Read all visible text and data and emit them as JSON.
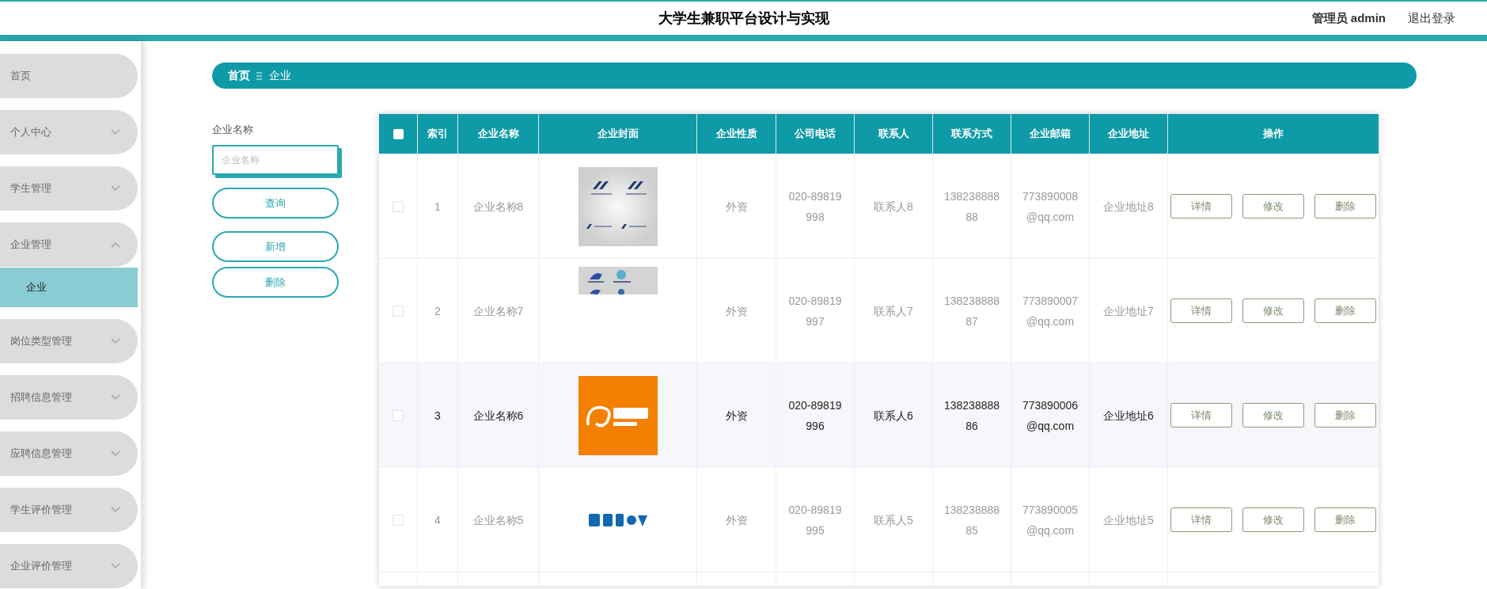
{
  "header": {
    "title": "大学生兼职平台设计与实现",
    "user": "管理员 admin",
    "logout": "退出登录"
  },
  "sidebar": {
    "items": [
      {
        "label": "首页",
        "selected": false
      },
      {
        "label": "个人中心",
        "selected": false,
        "expanded": false
      },
      {
        "label": "学生管理",
        "selected": false,
        "expanded": false
      },
      {
        "label": "企业管理",
        "selected": false,
        "expanded": true,
        "children": [
          {
            "label": "企业",
            "selected": true
          }
        ]
      },
      {
        "label": "岗位类型管理",
        "selected": false,
        "expanded": false
      },
      {
        "label": "招聘信息管理",
        "selected": false,
        "expanded": false
      },
      {
        "label": "应聘信息管理",
        "selected": false,
        "expanded": false
      },
      {
        "label": "学生评价管理",
        "selected": false,
        "expanded": false
      },
      {
        "label": "企业评价管理",
        "selected": false,
        "expanded": false
      }
    ]
  },
  "breadcrumb": [
    "首页",
    "企业"
  ],
  "search": {
    "label": "企业名称",
    "placeholder": "企业名称",
    "buttons": [
      "查询",
      "新增",
      "删除"
    ]
  },
  "table": {
    "columns": [
      "索引",
      "企业名称",
      "企业封面",
      "企业性质",
      "公司电话",
      "联系人",
      "联系方式",
      "企业邮箱",
      "企业地址",
      "操作"
    ],
    "select_all_checked": false,
    "rows": [
      {
        "checked": false,
        "hovered": false,
        "index": "1",
        "name": "企业名称8",
        "cover": {
          "kind": "picture"
        },
        "nature": "外资",
        "phone": "020-89819998",
        "contact": "联系人8",
        "mobile": "13823888888",
        "email": "773890008@qq.com",
        "address": "企业地址8",
        "actions": [
          "详情",
          "修改",
          "删除"
        ]
      },
      {
        "checked": false,
        "hovered": false,
        "index": "2",
        "name": "企业名称7",
        "cover": {
          "kind": "picture"
        },
        "nature": "外资",
        "phone": "020-89819997",
        "contact": "联系人7",
        "mobile": "13823888887",
        "email": "773890007@qq.com",
        "address": "企业地址7",
        "actions": [
          "详情",
          "修改",
          "删除"
        ]
      },
      {
        "checked": false,
        "hovered": true,
        "index": "3",
        "name": "企业名称6",
        "cover": {
          "kind": "picture"
        },
        "nature": "外资",
        "phone": "020-89819996",
        "contact": "联系人6",
        "mobile": "13823888886",
        "email": "773890006@qq.com",
        "address": "企业地址6",
        "actions": [
          "详情",
          "修改",
          "删除"
        ]
      },
      {
        "checked": false,
        "hovered": false,
        "index": "4",
        "name": "企业名称5",
        "cover": {
          "kind": "picture"
        },
        "nature": "外资",
        "phone": "020-89819995",
        "contact": "联系人5",
        "mobile": "13823888885",
        "email": "773890005@qq.com",
        "address": "企业地址5",
        "actions": [
          "详情",
          "修改",
          "删除"
        ]
      }
    ]
  }
}
